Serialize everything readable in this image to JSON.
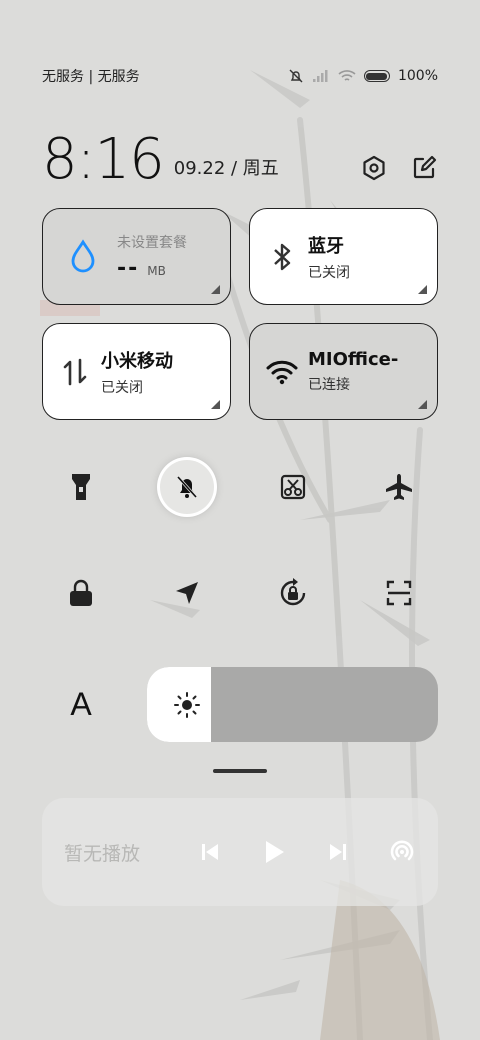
{
  "status_bar": {
    "carrier": "无服务 | 无服务",
    "icons": [
      "bell-off-icon",
      "signal-icon",
      "wifi-icon",
      "battery-icon"
    ],
    "battery_level": "100%"
  },
  "header": {
    "time": "8:16",
    "date": "09.22 / 周五",
    "actions": [
      "settings-icon",
      "edit-icon"
    ]
  },
  "tiles": {
    "data": {
      "title": "未设置套餐",
      "value": "--",
      "unit": "MB",
      "icon": "water-drop-icon"
    },
    "bluetooth": {
      "title": "蓝牙",
      "status": "已关闭",
      "icon": "bluetooth-icon"
    },
    "mobile": {
      "title": "小米移动",
      "status": "已关闭",
      "icon": "mobile-data-icon"
    },
    "wifi": {
      "title": "MIOffice-",
      "status": "已连接",
      "icon": "wifi-icon"
    }
  },
  "quick_settings": {
    "row1": [
      "flashlight-icon",
      "mute-icon",
      "screenshot-icon",
      "airplane-icon"
    ],
    "row2": [
      "lock-icon",
      "location-icon",
      "rotation-lock-icon",
      "scan-icon"
    ],
    "active": "mute-icon"
  },
  "brightness": {
    "level": 0.22,
    "font_label": "A"
  },
  "media": {
    "label": "暂无播放",
    "controls": [
      "previous-icon",
      "play-icon",
      "next-icon",
      "cast-icon"
    ]
  },
  "colors": {
    "accent_blue": "#1e90ff",
    "tile_on": "#ffffff",
    "tile_off": "#d6d6d4"
  }
}
